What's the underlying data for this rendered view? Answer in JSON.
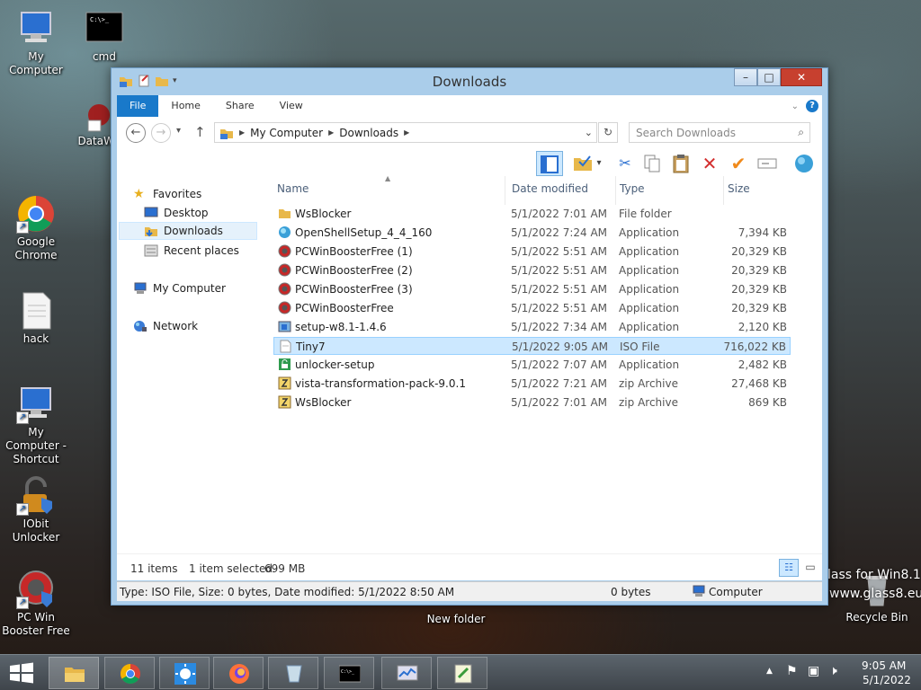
{
  "desktop": {
    "icons": [
      {
        "label": "My Computer"
      },
      {
        "label": "cmd"
      },
      {
        "label": "DataWa"
      },
      {
        "label": "Google Chrome"
      },
      {
        "label": "hack"
      },
      {
        "label": "My Computer - Shortcut"
      },
      {
        "label": "IObit Unlocker"
      },
      {
        "label": "PC Win Booster Free"
      },
      {
        "label": "New folder"
      },
      {
        "label": "Recycle Bin"
      }
    ],
    "background_text": [
      "lass for Win8.1",
      "www.glass8.eu"
    ]
  },
  "window": {
    "title": "Downloads",
    "controls": {
      "minimize": "–",
      "maximize": "□",
      "close": "✕"
    },
    "ribbon_tabs": [
      "File",
      "Home",
      "Share",
      "View"
    ],
    "help": "?",
    "nav": {
      "back": "←",
      "forward": "→",
      "recent": "▾",
      "up": "↑"
    },
    "address": {
      "segments": [
        "My Computer",
        "Downloads"
      ]
    },
    "search_placeholder": "Search Downloads",
    "nav_pane": [
      {
        "label": "Favorites"
      },
      {
        "label": "Desktop"
      },
      {
        "label": "Downloads"
      },
      {
        "label": "Recent places"
      },
      {
        "label": "My Computer"
      },
      {
        "label": "Network"
      }
    ],
    "columns": [
      "Name",
      "Date modified",
      "Type",
      "Size"
    ],
    "files": [
      {
        "name": "WsBlocker",
        "date": "5/1/2022 7:01 AM",
        "type": "File folder",
        "size": "",
        "icon": "folder-icon"
      },
      {
        "name": "OpenShellSetup_4_4_160",
        "date": "5/1/2022 7:24 AM",
        "type": "Application",
        "size": "7,394 KB",
        "icon": "shell-icon"
      },
      {
        "name": "PCWinBoosterFree (1)",
        "date": "5/1/2022 5:51 AM",
        "type": "Application",
        "size": "20,329 KB",
        "icon": "booster-icon"
      },
      {
        "name": "PCWinBoosterFree (2)",
        "date": "5/1/2022 5:51 AM",
        "type": "Application",
        "size": "20,329 KB",
        "icon": "booster-icon"
      },
      {
        "name": "PCWinBoosterFree (3)",
        "date": "5/1/2022 5:51 AM",
        "type": "Application",
        "size": "20,329 KB",
        "icon": "booster-icon"
      },
      {
        "name": "PCWinBoosterFree",
        "date": "5/1/2022 5:51 AM",
        "type": "Application",
        "size": "20,329 KB",
        "icon": "booster-icon"
      },
      {
        "name": "setup-w8.1-1.4.6",
        "date": "5/1/2022 7:34 AM",
        "type": "Application",
        "size": "2,120 KB",
        "icon": "setup-icon"
      },
      {
        "name": "Tiny7",
        "date": "5/1/2022 9:05 AM",
        "type": "ISO File",
        "size": "716,022 KB",
        "icon": "iso-icon",
        "selected": true
      },
      {
        "name": "unlocker-setup",
        "date": "5/1/2022 7:07 AM",
        "type": "Application",
        "size": "2,482 KB",
        "icon": "unlocker-icon"
      },
      {
        "name": "vista-transformation-pack-9.0.1",
        "date": "5/1/2022 7:21 AM",
        "type": "zip Archive",
        "size": "27,468 KB",
        "icon": "zip-icon"
      },
      {
        "name": "WsBlocker",
        "date": "5/1/2022 7:01 AM",
        "type": "zip Archive",
        "size": "869 KB",
        "icon": "zip-icon"
      }
    ],
    "status": {
      "items": "11 items",
      "selected": "1 item selected",
      "selected_size": "699 MB"
    },
    "details": {
      "info": "Type: ISO File, Size: 0 bytes, Date modified: 5/1/2022 8:50 AM",
      "size": "0 bytes",
      "location": "Computer"
    }
  },
  "taskbar": {
    "apps": [
      "start-button",
      "file-explorer",
      "chrome",
      "settings-sun",
      "firefox",
      "glass-app",
      "cmd",
      "task-manager",
      "notepad-plus"
    ],
    "tray": {
      "time": "9:05 AM",
      "date": "5/1/2022",
      "chevron": "▲"
    }
  }
}
